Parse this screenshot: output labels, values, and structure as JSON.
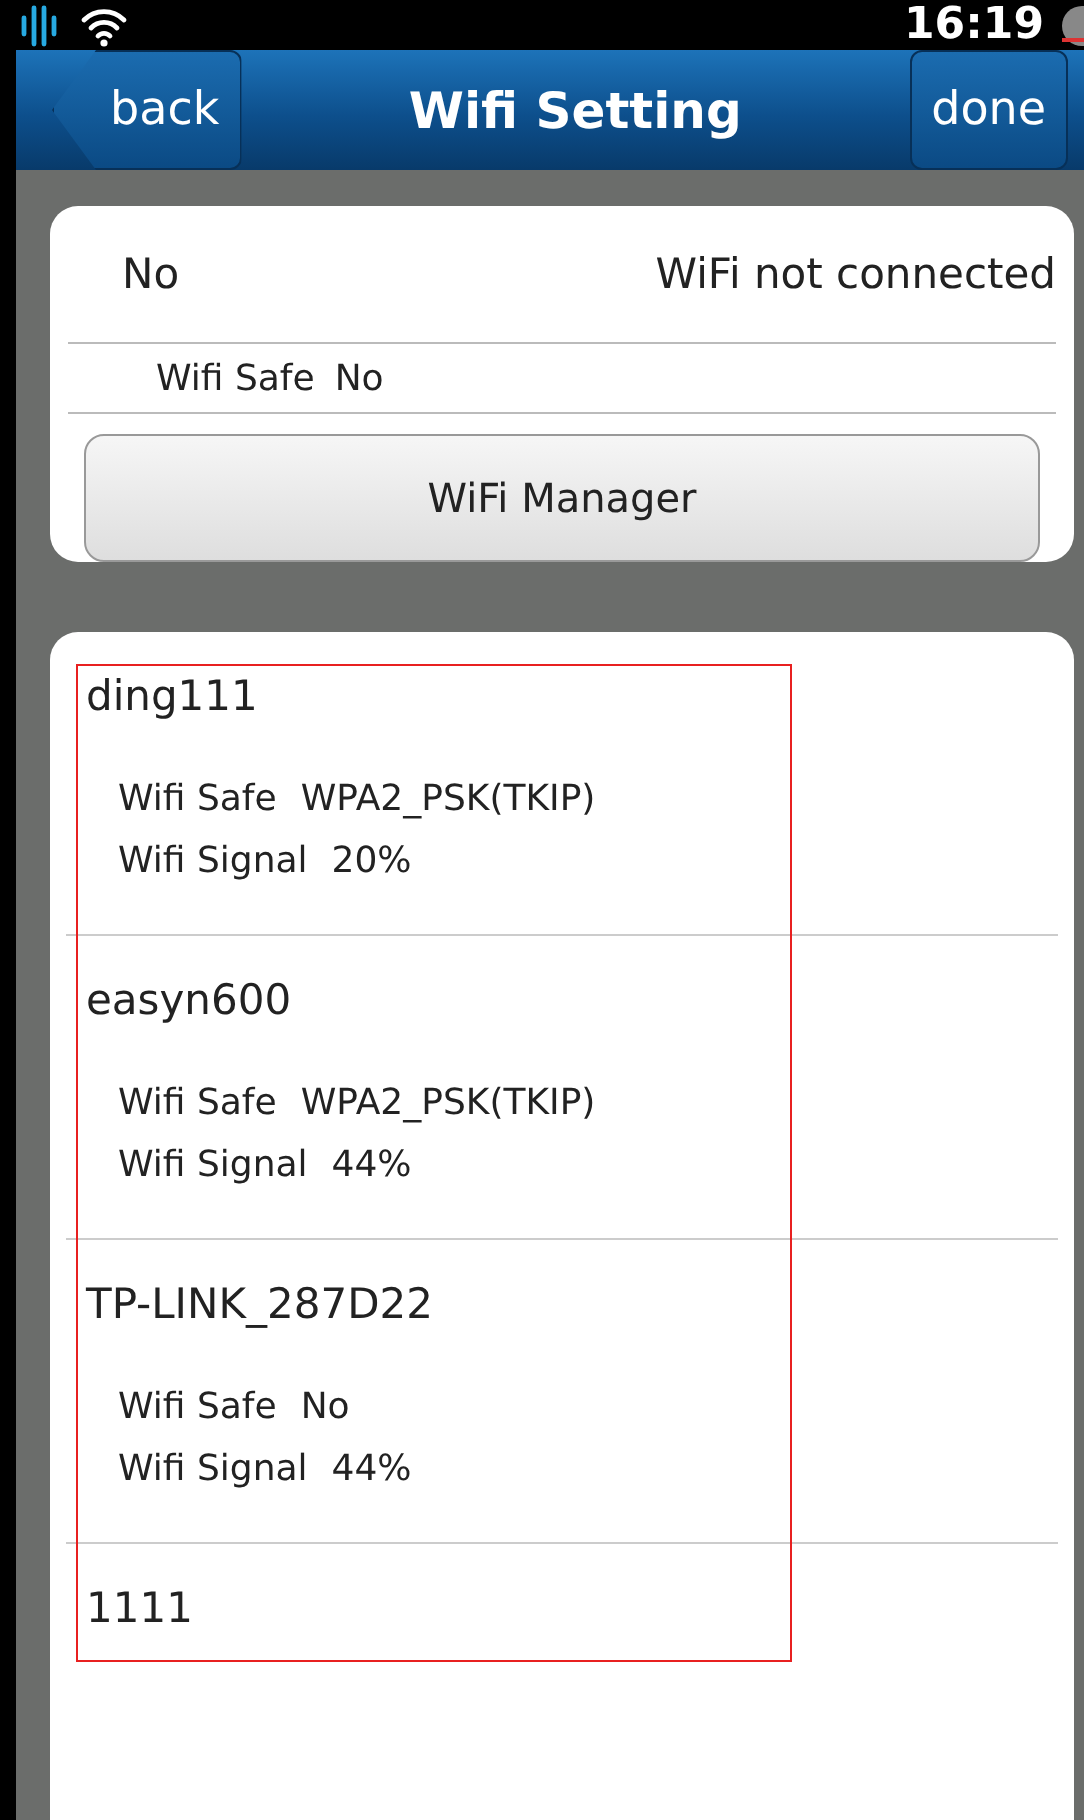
{
  "status_bar": {
    "time": "16:19"
  },
  "nav_bar": {
    "back": "back",
    "title": "Wifi Setting",
    "done": "done"
  },
  "current": {
    "name": "No",
    "status": "WiFi not connected",
    "safe_label": "Wifi Safe",
    "safe_value": "No",
    "button": "WiFi Manager"
  },
  "networks": [
    {
      "name": "ding111",
      "safe_label": "Wifi Safe",
      "safe_value": "WPA2_PSK(TKIP)",
      "signal_label": "Wifi Signal",
      "signal_value": "20%"
    },
    {
      "name": "easyn600",
      "safe_label": "Wifi Safe",
      "safe_value": "WPA2_PSK(TKIP)",
      "signal_label": "Wifi Signal",
      "signal_value": "44%"
    },
    {
      "name": "TP-LINK_287D22",
      "safe_label": "Wifi Safe",
      "safe_value": "No",
      "signal_label": "Wifi Signal",
      "signal_value": "44%"
    },
    {
      "name": "1111"
    }
  ]
}
